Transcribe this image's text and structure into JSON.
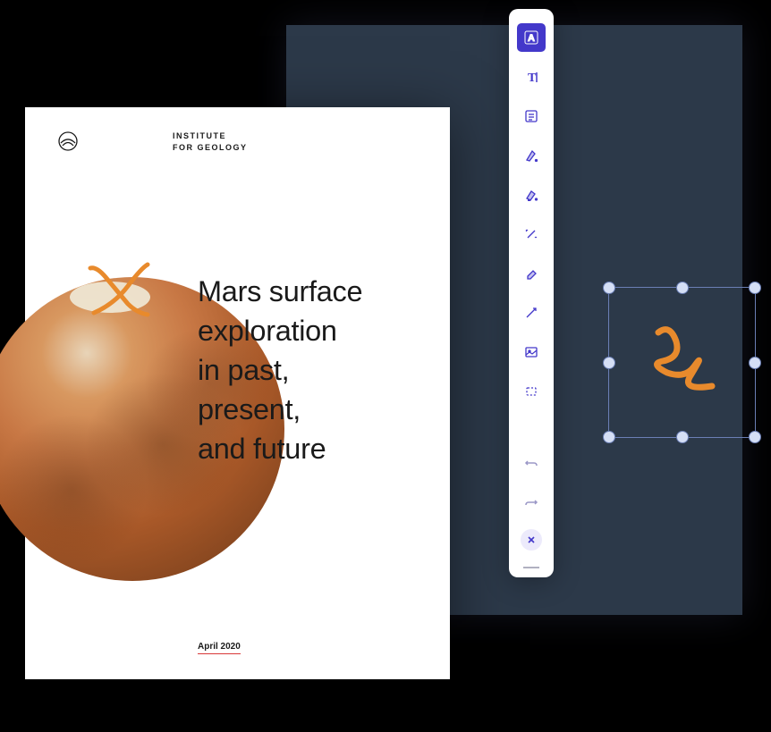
{
  "document": {
    "institute_line1": "INSTITUTE",
    "institute_line2": "FOR GEOLOGY",
    "title_pre": "Ma",
    "title_highlight": "rs sur",
    "title_post": "face\nexploration\nin past,\npresent,\nand future",
    "date": "April 2020"
  },
  "toolbar": {
    "tools": [
      {
        "name": "text-annotation",
        "active": true
      },
      {
        "name": "text-cursor",
        "active": false
      },
      {
        "name": "note",
        "active": false
      },
      {
        "name": "pen",
        "active": false
      },
      {
        "name": "highlighter",
        "active": false
      },
      {
        "name": "magic-wand",
        "active": false
      },
      {
        "name": "eraser",
        "active": false
      },
      {
        "name": "line-arrow",
        "active": false
      },
      {
        "name": "image",
        "active": false
      },
      {
        "name": "shape-rect",
        "active": false
      }
    ],
    "actions": [
      {
        "name": "undo"
      },
      {
        "name": "redo"
      }
    ]
  },
  "colors": {
    "accent": "#4338ca",
    "highlight": "#ffe66d",
    "annotation_orange": "#e88a2c",
    "panel_dark": "#2c3949"
  }
}
